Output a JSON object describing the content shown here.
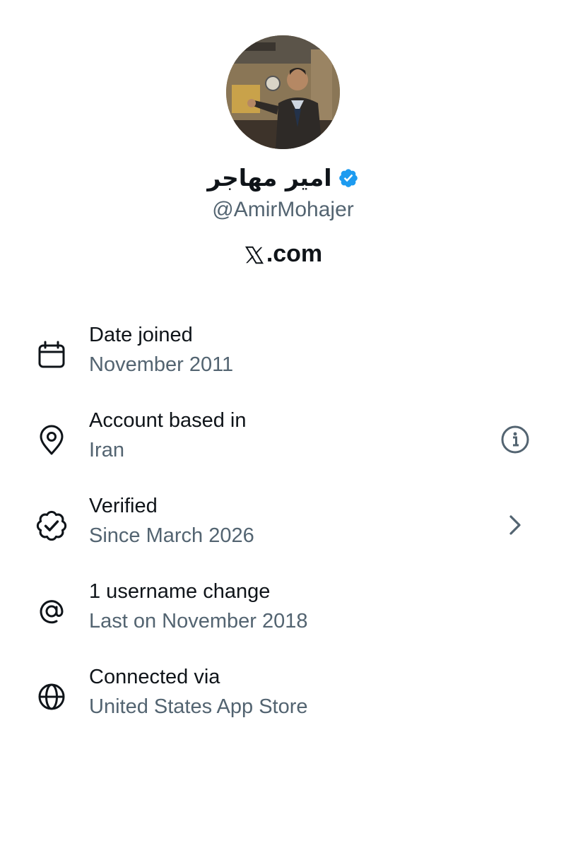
{
  "profile": {
    "display_name": "امیر مهاجر",
    "handle": "@AmirMohajer",
    "site_label": ".com",
    "verified_color": "#1d9bf0"
  },
  "rows": [
    {
      "icon": "calendar-icon",
      "title": "Date joined",
      "subtitle": "November 2011"
    },
    {
      "icon": "location-pin-icon",
      "title": "Account based in",
      "subtitle": "Iran",
      "trailing": "info-icon"
    },
    {
      "icon": "verified-badge-icon",
      "title": "Verified",
      "subtitle": "Since March 2026",
      "trailing": "chevron-right-icon"
    },
    {
      "icon": "at-sign-icon",
      "title": "1 username change",
      "subtitle": "Last on November 2018"
    },
    {
      "icon": "globe-icon",
      "title": "Connected via",
      "subtitle": "United States App Store"
    }
  ],
  "colors": {
    "primary_text": "#0f1419",
    "secondary_text": "#536471"
  }
}
